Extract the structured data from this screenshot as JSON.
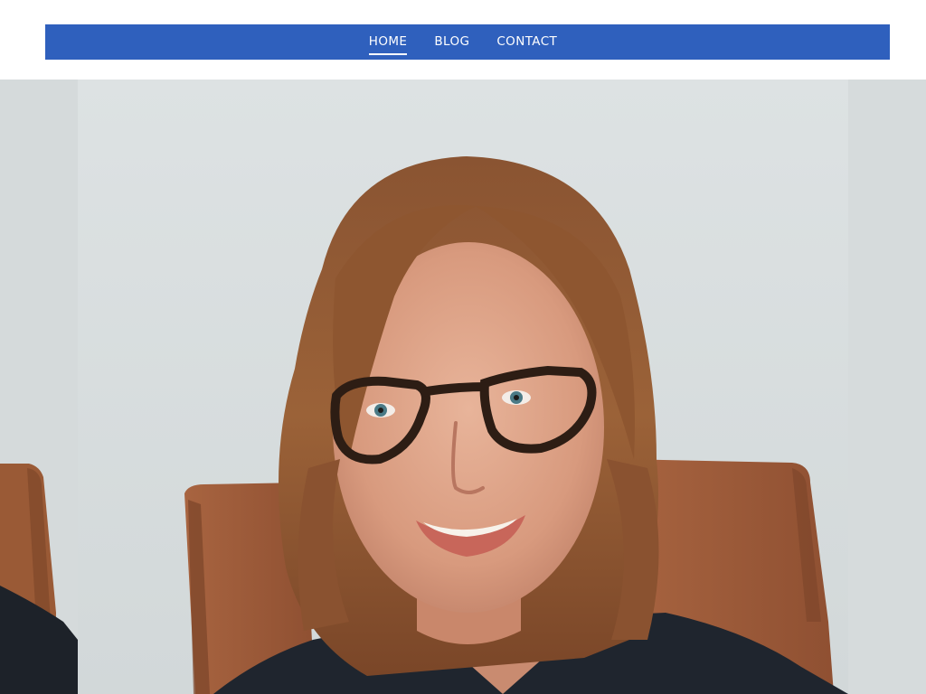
{
  "nav": {
    "items": [
      {
        "label": "HOME",
        "active": true
      },
      {
        "label": "BLOG",
        "active": false
      },
      {
        "label": "CONTACT",
        "active": false
      }
    ]
  },
  "colors": {
    "nav_background": "#2f60bd",
    "nav_text": "#ffffff",
    "hero_background": "#d7dcdd"
  },
  "hero": {
    "image_subject": "portrait-photo"
  }
}
